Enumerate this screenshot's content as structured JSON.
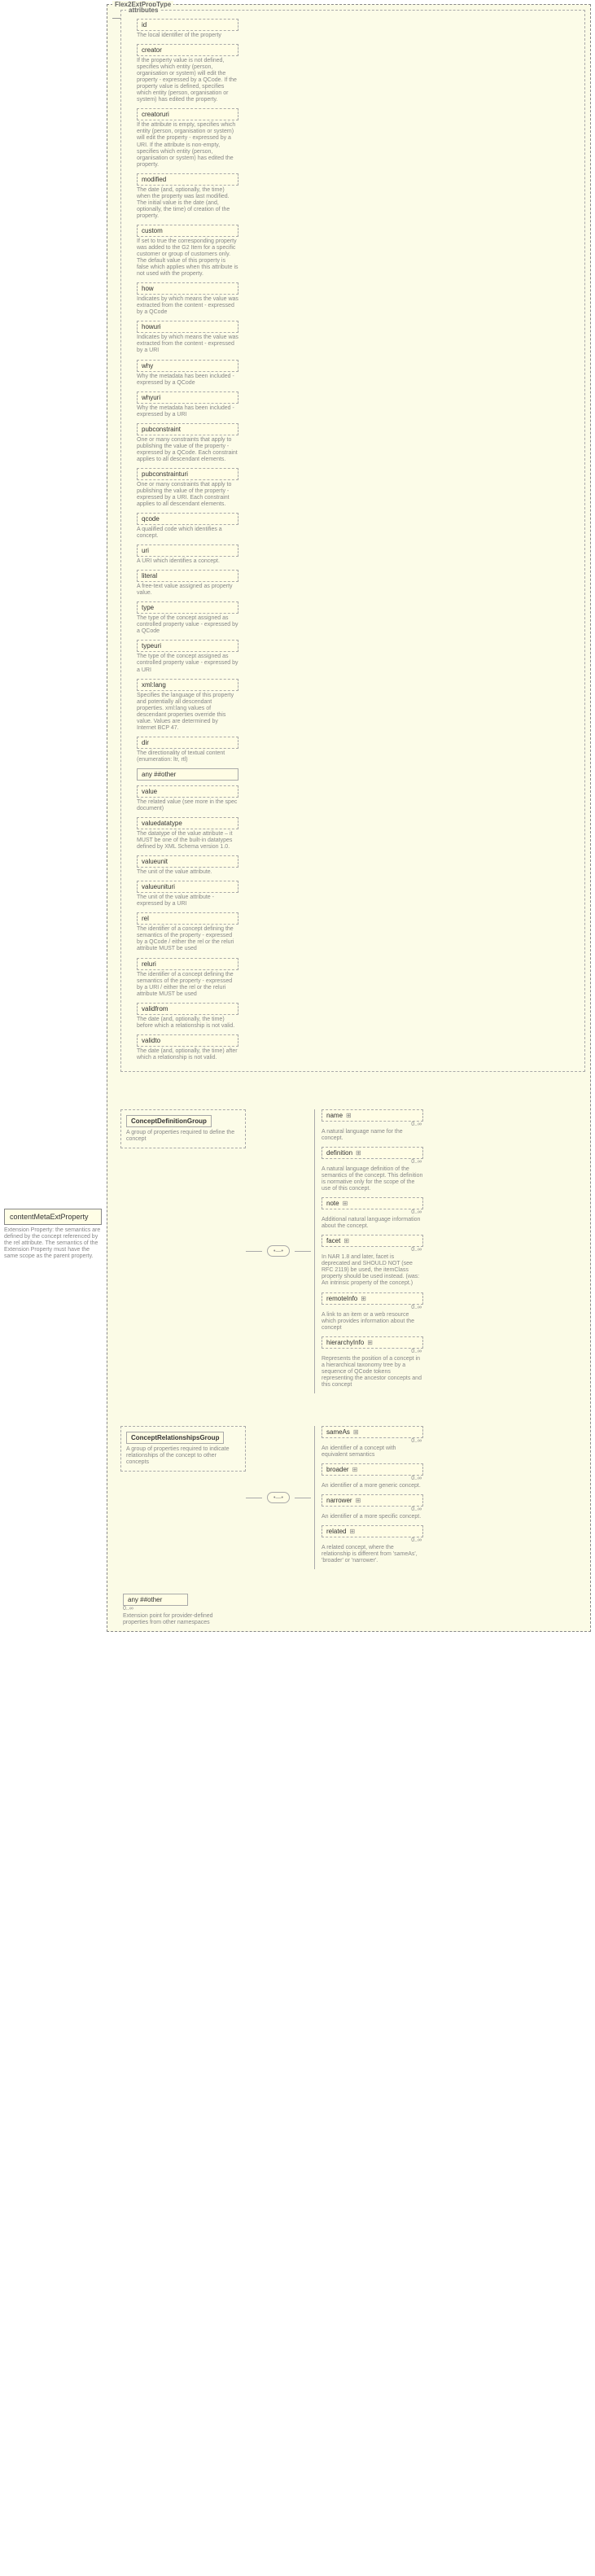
{
  "frame": {
    "title": "Flex2ExtPropType",
    "attributes_label": "attributes"
  },
  "root": {
    "label": "contentMetaExtProperty",
    "desc": "Extension Property: the semantics are defined by the concept referenced by the rel attribute. The semantics of the Extension Property must have the same scope as the parent property."
  },
  "attrs": [
    {
      "name": "id",
      "dashed": true,
      "zig": true,
      "desc": "The local identifier of the property"
    },
    {
      "name": "creator",
      "dashed": true,
      "zig": true,
      "desc": "If the property value is not defined, specifies which entity (person, organisation or system) will edit the property - expressed by a QCode. If the property value is defined, specifies which entity (person, organisation or system) has edited the property."
    },
    {
      "name": "creatoruri",
      "dashed": true,
      "zig": true,
      "desc": "If the attribute is empty, specifies which entity (person, organisation or system) will edit the property - expressed by a URI. If the attribute is non-empty, specifies which entity (person, organisation or system) has edited the property."
    },
    {
      "name": "modified",
      "dashed": true,
      "zig": true,
      "desc": "The date (and, optionally, the time) when the property was last modified. The initial value is the date (and, optionally, the time) of creation of the property."
    },
    {
      "name": "custom",
      "dashed": true,
      "zig": true,
      "desc": "If set to true the corresponding property was added to the G2 Item for a specific customer or group of customers only. The default value of this property is false which applies when this attribute is not used with the property."
    },
    {
      "name": "how",
      "dashed": true,
      "zig": true,
      "desc": "Indicates by which means the value was extracted from the content - expressed by a QCode"
    },
    {
      "name": "howuri",
      "dashed": true,
      "zig": true,
      "desc": "Indicates by which means the value was extracted from the content - expressed by a URI"
    },
    {
      "name": "why",
      "dashed": true,
      "zig": true,
      "desc": "Why the metadata has been included - expressed by a QCode"
    },
    {
      "name": "whyuri",
      "dashed": true,
      "zig": true,
      "desc": "Why the metadata has been included - expressed by a URI"
    },
    {
      "name": "pubconstraint",
      "dashed": true,
      "zig": true,
      "desc": "One or many constraints that apply to publishing the value of the property - expressed by a QCode. Each constraint applies to all descendant elements."
    },
    {
      "name": "pubconstrainturi",
      "dashed": true,
      "zig": true,
      "desc": "One or many constraints that apply to publishing the value of the property - expressed by a URI. Each constraint applies to all descendant elements."
    },
    {
      "name": "qcode",
      "dashed": true,
      "zig": true,
      "desc": "A qualified code which identifies a concept."
    },
    {
      "name": "uri",
      "dashed": true,
      "zig": true,
      "desc": "A URI which identifies a concept."
    },
    {
      "name": "literal",
      "dashed": true,
      "zig": true,
      "desc": "A free-text value assigned as property value."
    },
    {
      "name": "type",
      "dashed": true,
      "zig": true,
      "desc": "The type of the concept assigned as controlled property value - expressed by a QCode"
    },
    {
      "name": "typeuri",
      "dashed": true,
      "zig": true,
      "desc": "The type of the concept assigned as controlled property value - expressed by a URI"
    },
    {
      "name": "xml:lang",
      "dashed": true,
      "zig": true,
      "desc": "Specifies the language of this property and potentially all descendant properties. xml:lang values of descendant properties override this value. Values are determined by Internet BCP 47."
    },
    {
      "name": "dir",
      "dashed": true,
      "zig": true,
      "desc": "The directionality of textual content (enumeration: ltr, rtl)"
    },
    {
      "name": "any ##other",
      "dashed": false,
      "zig": false,
      "desc": ""
    },
    {
      "name": "value",
      "dashed": true,
      "zig": true,
      "desc": "The related value (see more in the spec document)"
    },
    {
      "name": "valuedatatype",
      "dashed": true,
      "zig": true,
      "desc": "The datatype of the value attribute – it MUST be one of the built-in datatypes defined by XML Schema version 1.0."
    },
    {
      "name": "valueunit",
      "dashed": true,
      "zig": true,
      "desc": "The unit of the value attribute."
    },
    {
      "name": "valueunituri",
      "dashed": true,
      "zig": true,
      "desc": "The unit of the value attribute - expressed by a URI"
    },
    {
      "name": "rel",
      "dashed": true,
      "zig": true,
      "desc": "The identifier of a concept defining the semantics of the property - expressed by a QCode / either the rel or the reluri attribute MUST be used"
    },
    {
      "name": "reluri",
      "dashed": true,
      "zig": true,
      "desc": "The identifier of a concept defining the semantics of the property - expressed by a URI / either the rel or the reluri attribute MUST be used"
    },
    {
      "name": "validfrom",
      "dashed": true,
      "zig": true,
      "desc": "The date (and, optionally, the time) before which a relationship is not valid."
    },
    {
      "name": "validto",
      "dashed": true,
      "zig": true,
      "desc": "The date (and, optionally, the time) after which a relationship is not valid."
    }
  ],
  "concept_def": {
    "label": "ConceptDefinitionGroup",
    "desc": "A group of properties required to define the concept",
    "children": [
      {
        "name": "name",
        "card": "0..∞",
        "dashed": true,
        "desc": "A natural language name for the concept."
      },
      {
        "name": "definition",
        "card": "0..∞",
        "dashed": true,
        "desc": "A natural language definition of the semantics of the concept. This definition is normative only for the scope of the use of this concept."
      },
      {
        "name": "note",
        "card": "0..∞",
        "dashed": true,
        "desc": "Additional natural language information about the concept."
      },
      {
        "name": "facet",
        "card": "0..∞",
        "dashed": true,
        "desc": "In NAR 1.8 and later, facet is deprecated and SHOULD NOT (see RFC 2119) be used, the itemClass property should be used instead. (was: An intrinsic property of the concept.)"
      },
      {
        "name": "remoteInfo",
        "card": "0..∞",
        "dashed": true,
        "desc": "A link to an item or a web resource which provides information about the concept"
      },
      {
        "name": "hierarchyInfo",
        "card": "0..∞",
        "dashed": true,
        "desc": "Represents the position of a concept in a hierarchical taxonomy tree by a sequence of QCode tokens representing the ancestor concepts and this concept"
      }
    ]
  },
  "concept_rel": {
    "label": "ConceptRelationshipsGroup",
    "desc": "A group of properties required to indicate relationships of the concept to other concepts",
    "children": [
      {
        "name": "sameAs",
        "card": "0..∞",
        "dashed": true,
        "desc": "An identifier of a concept with equivalent semantics"
      },
      {
        "name": "broader",
        "card": "0..∞",
        "dashed": true,
        "desc": "An identifier of a more generic concept."
      },
      {
        "name": "narrower",
        "card": "0..∞",
        "dashed": true,
        "desc": "An identifier of a more specific concept."
      },
      {
        "name": "related",
        "card": "0..∞",
        "dashed": true,
        "desc": "A related concept, where the relationship is different from 'sameAs', 'broader' or 'narrower'."
      }
    ]
  },
  "any_other": {
    "label": "any ##other",
    "card": "0..∞",
    "desc": "Extension point for provider-defined properties from other namespaces"
  },
  "compositor": "•—•"
}
